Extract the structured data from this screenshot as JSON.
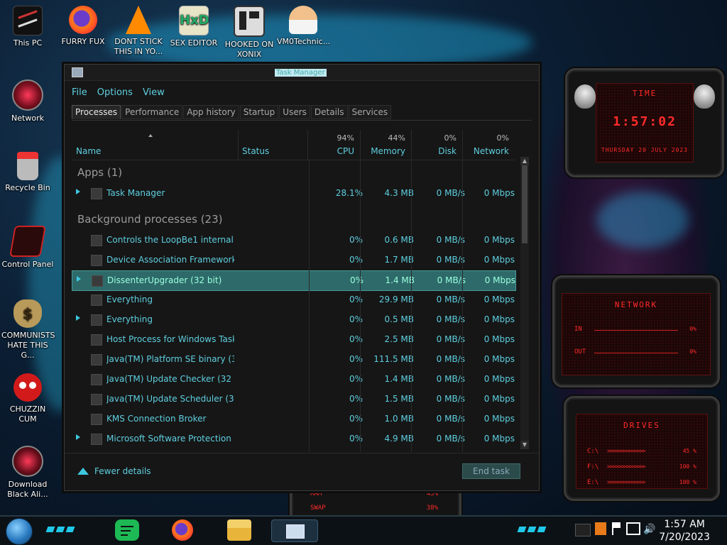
{
  "desktop": {
    "icons": [
      {
        "label": "This PC",
        "icon": "computer-icon"
      },
      {
        "label": "FURRY FUX",
        "icon": "firefox-icon"
      },
      {
        "label": "DONT STICK THIS IN YO...",
        "icon": "vlc-icon"
      },
      {
        "label": "SEX EDITOR",
        "icon": "hxd-icon"
      },
      {
        "label": "HOOKED ON XONIX",
        "icon": "game-icon"
      },
      {
        "label": "VM0Technic...",
        "icon": "doctor-icon"
      },
      {
        "label": "Network",
        "icon": "network-icon"
      },
      {
        "label": "Recycle Bin",
        "icon": "recycle-bin-icon"
      },
      {
        "label": "Control Panel",
        "icon": "control-panel-icon"
      },
      {
        "label": "COMMUNISTS HATE THIS G...",
        "icon": "money-bag-icon"
      },
      {
        "label": "CHUZZIN CUM",
        "icon": "chuzzle-icon"
      },
      {
        "label": "Download Black Ali...",
        "icon": "alien-icon"
      }
    ]
  },
  "widgets": {
    "time": {
      "title": "TIME",
      "time": "1:57:02",
      "date": "THURSDAY 20 JULY 2023"
    },
    "network": {
      "title": "NETWORK",
      "in_label": "IN",
      "out_label": "OUT",
      "in_pct": "0%",
      "out_pct": "0%"
    },
    "drives": {
      "title": "DRIVES",
      "items": [
        {
          "label": "C:\\",
          "pct": "45 %"
        },
        {
          "label": "F:\\",
          "pct": "100 %"
        },
        {
          "label": "E:\\",
          "pct": "100 %"
        }
      ]
    },
    "memory": {
      "ram_label": "RAM",
      "ram_pct": "45%",
      "swap_label": "SWAP",
      "swap_pct": "38%"
    }
  },
  "task_manager": {
    "title": "Task Manager",
    "menu": [
      "File",
      "Options",
      "View"
    ],
    "tabs": [
      "Processes",
      "Performance",
      "App history",
      "Startup",
      "Users",
      "Details",
      "Services"
    ],
    "columns": {
      "name": "Name",
      "status": "Status",
      "cpu": {
        "pct": "94%",
        "label": "CPU"
      },
      "memory": {
        "pct": "44%",
        "label": "Memory"
      },
      "disk": {
        "pct": "0%",
        "label": "Disk"
      },
      "network": {
        "pct": "0%",
        "label": "Network"
      }
    },
    "apps_header": "Apps (1)",
    "apps": [
      {
        "name": "Task Manager",
        "cpu": "28.1%",
        "memory": "4.3 MB",
        "disk": "0 MB/s",
        "network": "0 Mbps",
        "expandable": true
      }
    ],
    "bg_header": "Background processes (23)",
    "background": [
      {
        "name": "Controls the LoopBe1 internal ...",
        "cpu": "0%",
        "memory": "0.6 MB",
        "disk": "0 MB/s",
        "network": "0 Mbps",
        "expandable": false
      },
      {
        "name": "Device Association Framework ...",
        "cpu": "0%",
        "memory": "1.7 MB",
        "disk": "0 MB/s",
        "network": "0 Mbps",
        "expandable": false
      },
      {
        "name": "DissenterUpgrader (32 bit)",
        "cpu": "0%",
        "memory": "1.4 MB",
        "disk": "0 MB/s",
        "network": "0 Mbps",
        "expandable": true,
        "selected": true
      },
      {
        "name": "Everything",
        "cpu": "0%",
        "memory": "29.9 MB",
        "disk": "0 MB/s",
        "network": "0 Mbps",
        "expandable": false
      },
      {
        "name": "Everything",
        "cpu": "0%",
        "memory": "0.5 MB",
        "disk": "0 MB/s",
        "network": "0 Mbps",
        "expandable": true
      },
      {
        "name": "Host Process for Windows Tasks",
        "cpu": "0%",
        "memory": "2.5 MB",
        "disk": "0 MB/s",
        "network": "0 Mbps",
        "expandable": false
      },
      {
        "name": "Java(TM) Platform SE binary (32...",
        "cpu": "0%",
        "memory": "111.5 MB",
        "disk": "0 MB/s",
        "network": "0 Mbps",
        "expandable": false
      },
      {
        "name": "Java(TM) Update Checker (32 bit)",
        "cpu": "0%",
        "memory": "1.4 MB",
        "disk": "0 MB/s",
        "network": "0 Mbps",
        "expandable": false
      },
      {
        "name": "Java(TM) Update Scheduler (32 ...",
        "cpu": "0%",
        "memory": "1.5 MB",
        "disk": "0 MB/s",
        "network": "0 Mbps",
        "expandable": false
      },
      {
        "name": "KMS Connection Broker",
        "cpu": "0%",
        "memory": "1.0 MB",
        "disk": "0 MB/s",
        "network": "0 Mbps",
        "expandable": false
      },
      {
        "name": "Microsoft Software Protection P...",
        "cpu": "0%",
        "memory": "4.9 MB",
        "disk": "0 MB/s",
        "network": "0 Mbps",
        "expandable": true
      }
    ],
    "fewer_details": "Fewer details",
    "end_task": "End task"
  },
  "taskbar": {
    "apps": [
      "spotify-icon",
      "firefox-icon",
      "file-explorer-icon",
      "task-manager-icon"
    ],
    "time": "1:57 AM",
    "date": "7/20/2023"
  }
}
